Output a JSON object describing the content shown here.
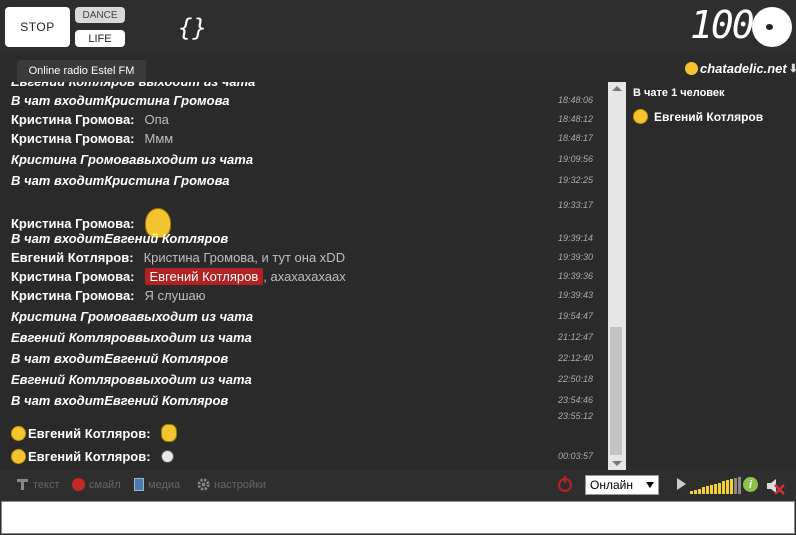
{
  "topbar": {
    "stop_label": "STOP",
    "dance_label": "DANCE",
    "life_label": "LIFE",
    "visual_glyph": "{}",
    "volume_value": "100"
  },
  "station": {
    "name": "Online radio Estel FM"
  },
  "brand": {
    "name": "chatadelic.net"
  },
  "chat": {
    "messages": [
      {
        "type": "sys",
        "text": "Евгений Котляров выходит из чата",
        "time": ""
      },
      {
        "type": "sys",
        "prefix": "В чат входит ",
        "name": "Кристина Громова",
        "time": "18:48:06"
      },
      {
        "type": "user",
        "nick": "Кристина Громова:",
        "text": "Опа",
        "time": "18:48:12"
      },
      {
        "type": "user",
        "nick": "Кристина Громова:",
        "text": "Ммм",
        "time": "18:48:17"
      },
      {
        "type": "sys",
        "name": "Кристина Громова",
        "suffix": " выходит из чата",
        "time": "19:09:56"
      },
      {
        "type": "sys",
        "prefix": "В чат входит ",
        "name": "Кристина Громова",
        "time": "19:32:25"
      },
      {
        "type": "user",
        "nick": "Кристина Громова:",
        "emote": "angel",
        "time": "19:33:17"
      },
      {
        "type": "sys",
        "prefix": "В чат входит ",
        "name": "Евгений Котляров",
        "time": "19:39:14"
      },
      {
        "type": "user",
        "nick": "Евгений Котляров:",
        "text": "Кристина Громова, и тут она xDD",
        "time": "19:39:30"
      },
      {
        "type": "user",
        "nick": "Кристина Громова:",
        "highlight": "Евгений Котляров",
        "text": ", ахахахахаах",
        "time": "19:39:36"
      },
      {
        "type": "user",
        "nick": "Кристина Громова:",
        "text": "Я слушаю",
        "time": "19:39:43"
      },
      {
        "type": "sys",
        "name": "Кристина Громова",
        "suffix": " выходит из чата",
        "time": "19:54:47"
      },
      {
        "type": "sys",
        "name": "Евгений Котляров",
        "suffix": " выходит из чата",
        "time": "21:12:47"
      },
      {
        "type": "sys",
        "prefix": "В чат входит ",
        "name": "Евгений Котляров",
        "time": "22:12:40"
      },
      {
        "type": "sys",
        "name": "Евгений Котляров",
        "suffix": " выходит из чата",
        "time": "22:50:18"
      },
      {
        "type": "sys",
        "prefix": "В чат входит ",
        "name": "Евгений Котляров",
        "time": "23:54:46"
      },
      {
        "type": "user",
        "nick": "Евгений Котляров:",
        "emote": "music",
        "time": "23:55:12"
      },
      {
        "type": "user",
        "nick": "Евгений Котляров:",
        "emote": "ball",
        "time": "00:03:57"
      }
    ]
  },
  "users": {
    "title": "В чате 1 человек",
    "list": [
      "Евгений Котляров"
    ]
  },
  "toolbar": {
    "text_label": "текст",
    "smile_label": "смайл",
    "media_label": "медиа",
    "settings_label": "настройки",
    "status_value": "Онлайн"
  },
  "input": {
    "placeholder": ""
  },
  "colors": {
    "background": "#2b2b2b",
    "highlight": "#b22222",
    "timestamp": "#aaaaaa",
    "power": "#c02020",
    "info": "#8bc34a"
  }
}
